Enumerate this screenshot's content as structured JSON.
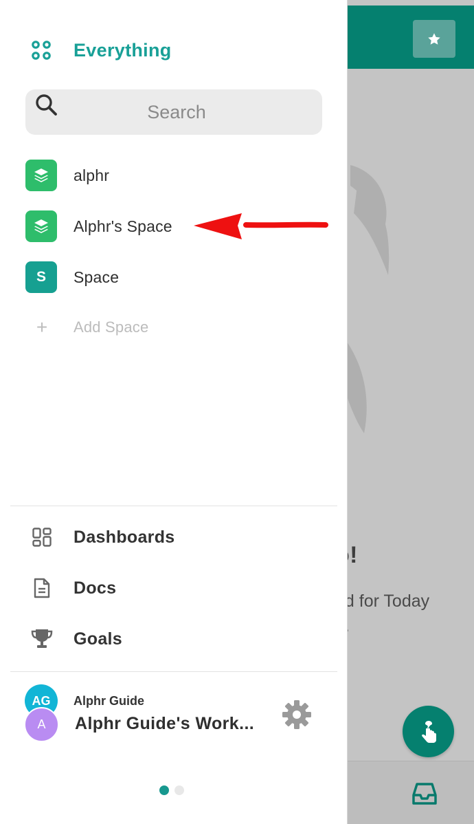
{
  "colors": {
    "accent": "#19a097",
    "topbar": "#05806f",
    "space_green": "#2ebd6b",
    "space_teal": "#16a091",
    "avatar_ag": "#12b5d6",
    "avatar_a": "#b98cf2",
    "annotation_arrow": "#ee1111"
  },
  "sidebar": {
    "everything_label": "Everything",
    "search": {
      "placeholder": "Search",
      "value": ""
    },
    "spaces": [
      {
        "label": "alphr",
        "avatar_icon": "layers-icon"
      },
      {
        "label": "Alphr's Space",
        "avatar_icon": "layers-icon"
      },
      {
        "label": "Space",
        "avatar_letter": "S"
      }
    ],
    "add_space_label": "Add Space",
    "nav": [
      {
        "label": "Dashboards",
        "icon": "dashboard-grid-icon"
      },
      {
        "label": "Docs",
        "icon": "document-icon"
      },
      {
        "label": "Goals",
        "icon": "trophy-icon"
      }
    ],
    "workspace": {
      "avatar_initials": "AG",
      "secondary_avatar": "A",
      "user_name": "Alphr Guide",
      "workspace_name": "Alphr Guide's Work..."
    },
    "pagination": {
      "current": 1,
      "total": 2
    }
  },
  "background": {
    "heading_fragment": "o!",
    "subtext_fragment": "ed for Today\ne."
  }
}
